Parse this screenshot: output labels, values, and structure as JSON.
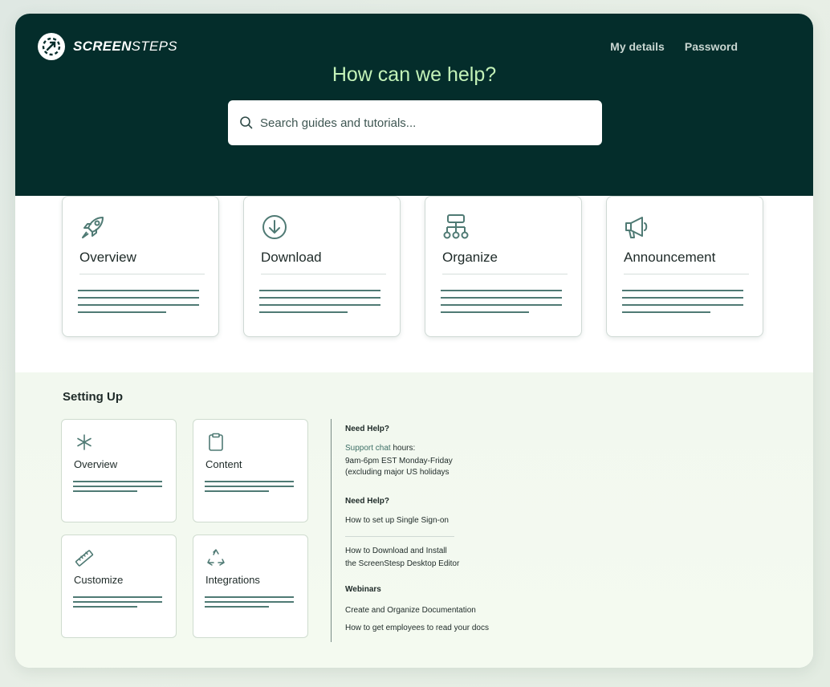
{
  "brand": {
    "name_bold": "SCREEN",
    "name_light": "STEPS"
  },
  "nav": {
    "my_details": "My details",
    "password": "Password"
  },
  "hero": {
    "title": "How can we help?",
    "search_placeholder": "Search guides and tutorials..."
  },
  "big_cards": [
    {
      "label": "Overview",
      "icon": "rocket-icon"
    },
    {
      "label": "Download",
      "icon": "download-icon"
    },
    {
      "label": "Organize",
      "icon": "sitemap-icon"
    },
    {
      "label": "Announcement",
      "icon": "megaphone-icon"
    }
  ],
  "setting_up": {
    "title": "Setting Up",
    "cards": [
      {
        "label": "Overview",
        "icon": "asterisk-icon"
      },
      {
        "label": "Content",
        "icon": "clipboard-icon"
      },
      {
        "label": "Customize",
        "icon": "ruler-icon"
      },
      {
        "label": "Integrations",
        "icon": "recycle-icon"
      }
    ]
  },
  "sidebar": {
    "help1_title": "Need Help?",
    "support_link": "Support chat",
    "support_suffix": " hours:",
    "hours_line1": "9am-6pm EST Monday-Friday",
    "hours_line2": "(excluding major US holidays",
    "help2_title": "Need Help?",
    "sso_link": "How to set up Single Sign-on",
    "download_link_line1": "How to Download and Install",
    "download_link_line2": "the ScreenStesp Desktop Editor",
    "webinars_title": "Webinars",
    "webinar1": "Create and Organize Documentation",
    "webinar2": "How to get employees to read your docs"
  },
  "colors": {
    "hero_bg": "#042d2b",
    "accent_green": "#c3f2b8",
    "line_teal": "#4f7a74",
    "link": "#3d6f66"
  }
}
